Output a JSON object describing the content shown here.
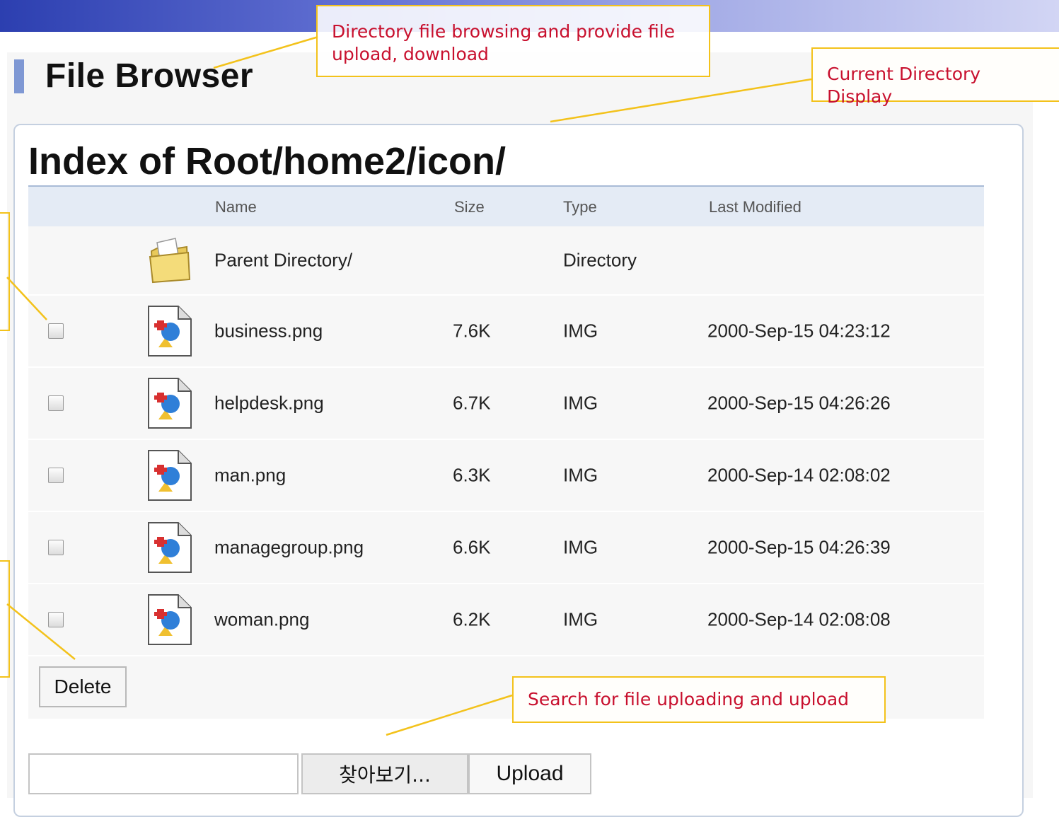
{
  "page": {
    "title": "File Browser",
    "index_heading": "Index of Root/home2/icon/"
  },
  "table": {
    "headers": {
      "name": "Name",
      "size": "Size",
      "type": "Type",
      "modified": "Last Modified"
    },
    "parent": {
      "name": "Parent Directory/",
      "type": "Directory",
      "icon": "folder-icon"
    },
    "rows": [
      {
        "name": "business.png",
        "size": "7.6K",
        "type": "IMG",
        "modified": "2000-Sep-15 04:23:12",
        "icon": "image-file-icon",
        "checked": false
      },
      {
        "name": "helpdesk.png",
        "size": "6.7K",
        "type": "IMG",
        "modified": "2000-Sep-15 04:26:26",
        "icon": "image-file-icon",
        "checked": false
      },
      {
        "name": "man.png",
        "size": "6.3K",
        "type": "IMG",
        "modified": "2000-Sep-14 02:08:02",
        "icon": "image-file-icon",
        "checked": false
      },
      {
        "name": "managegroup.png",
        "size": "6.6K",
        "type": "IMG",
        "modified": "2000-Sep-15 04:26:39",
        "icon": "image-file-icon",
        "checked": false
      },
      {
        "name": "woman.png",
        "size": "6.2K",
        "type": "IMG",
        "modified": "2000-Sep-14 02:08:08",
        "icon": "image-file-icon",
        "checked": false
      }
    ],
    "delete_label": "Delete"
  },
  "upload": {
    "file_value": "",
    "browse_label": "찾아보기...",
    "upload_label": "Upload"
  },
  "annotations": {
    "browse_note": "Directory file browsing and provide file upload, download",
    "current_dir_note": "Current Directory Display",
    "upload_note": "Search for file uploading and upload"
  },
  "colors": {
    "accent_bar": "#7f98d4",
    "header_bg": "#e4ebf5",
    "callout_border": "#f3c21b",
    "callout_text": "#c8102e"
  }
}
